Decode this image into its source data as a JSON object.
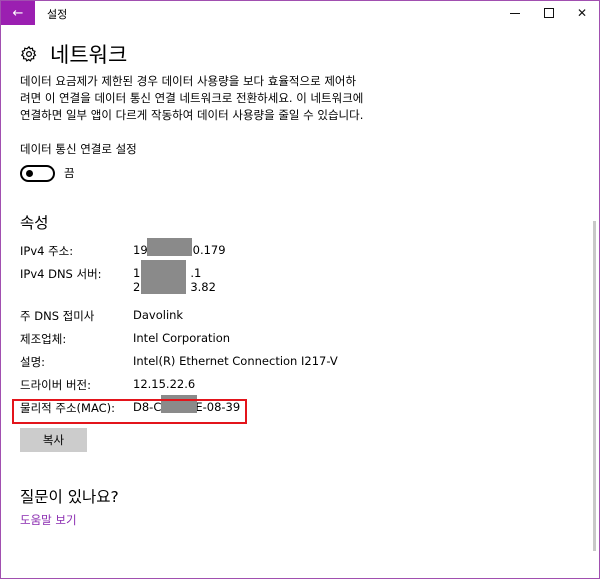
{
  "window": {
    "title": "설정",
    "accent_color": "#9b1fb1",
    "border_color": "#a14fb0"
  },
  "titlebar": {
    "back_icon": "back-arrow-icon",
    "minimize_icon": "minimize-icon",
    "maximize_icon": "maximize-icon",
    "close_icon": "close-icon",
    "back_glyph": "←",
    "close_glyph": "✕"
  },
  "page": {
    "icon": "gear-icon",
    "title": "네트워크",
    "description": "데이터 요금제가 제한된 경우 데이터 사용량을 보다 효율적으로 제어하려면 이 연결을 데이터 통신 연결 네트워크로 전환하세요. 이 네트워크에 연결하면 일부 앱이 다르게 작동하여 데이터 사용량을 줄일 수 있습니다."
  },
  "metered": {
    "label": "데이터 통신 연결로 설정",
    "toggle_state": "끔",
    "toggle_on": false
  },
  "properties": {
    "title": "속성",
    "ipv4_label": "IPv4 주소:",
    "ipv4_value_prefix": "19",
    "ipv4_value_suffix": "0.179",
    "dns_label": "IPv4 DNS 서버:",
    "dns_line1_prefix": "1",
    "dns_line1_suffix": ".1",
    "dns_line2_prefix": "2",
    "dns_line2_suffix": "3.82",
    "primary_dns_suffix_label": "주 DNS 접미사",
    "primary_dns_suffix_value": "Davolink",
    "manufacturer_label": "제조업체:",
    "manufacturer_value": "Intel Corporation",
    "description_label": "설명:",
    "description_value": "Intel(R) Ethernet Connection I217-V",
    "driver_label": "드라이버 버전:",
    "driver_value": "12.15.22.6",
    "mac_label": "물리적 주소(MAC):",
    "mac_value_prefix": "D8-C",
    "mac_value_suffix": "E-08-39",
    "highlight_color": "#e3141b",
    "copy_button": "복사"
  },
  "help": {
    "title": "질문이 있나요?",
    "link": "도움말 보기",
    "link_color": "#8a2bb0"
  }
}
